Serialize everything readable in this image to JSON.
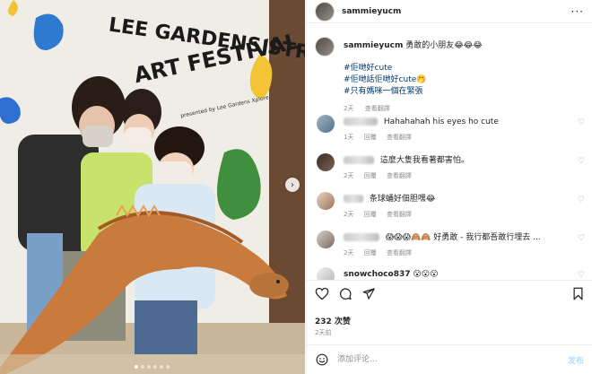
{
  "media": {
    "sign_line1": "LEE GARDENS STREET",
    "sign_line2": "ART FESTIVAL",
    "sign_sub": "presented by Lee Gardens Xplore",
    "carousel_dots": 6,
    "active_dot": 1
  },
  "header": {
    "username": "sammieyucm",
    "more": "···"
  },
  "caption": {
    "username": "sammieyucm",
    "text": "勇敢的小朋友😂😂😂",
    "hashtags": [
      "#佢哋好cute",
      "#佢哋話佢哋好cute🤭",
      "#只有媽咪一個在緊張"
    ],
    "time": "2天",
    "action": "查看翻譯"
  },
  "comments": [
    {
      "text": "Hahahahah his eyes ho cute",
      "time": "1天",
      "reply": "回覆",
      "translate": "查看翻譯"
    },
    {
      "text": "這麼大隻我看著都害怕。",
      "time": "2天",
      "reply": "回覆",
      "translate": "查看翻譯"
    },
    {
      "text": "条球蛹好佃胆嘿😂",
      "time": "2天",
      "reply": "回覆",
      "translate": "查看翻譯"
    },
    {
      "text": "😱😱😱🙈🙈 好勇敢 - 我行都吾敢行埋去 ...",
      "time": "2天",
      "reply": "回覆",
      "translate": "查看翻譯"
    },
    {
      "user": "snowchoco837",
      "text": "😮😮😮"
    }
  ],
  "actions": {
    "likes": "232 次赞",
    "date": "2天前"
  },
  "composer": {
    "placeholder": "添加评论...",
    "post": "发布"
  },
  "colors": {
    "link": "#00376b",
    "muted": "#8e8e8e",
    "post_disabled": "#b2dffc"
  }
}
